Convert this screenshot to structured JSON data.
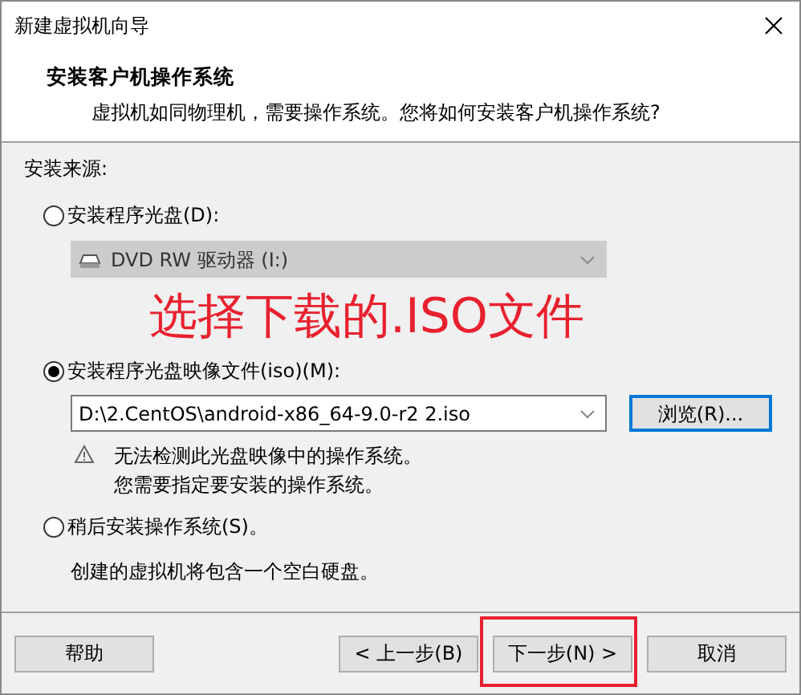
{
  "window": {
    "title": "新建虚拟机向导"
  },
  "header": {
    "title": "安装客户机操作系统",
    "subtitle": "虚拟机如同物理机，需要操作系统。您将如何安装客户机操作系统?"
  },
  "source_label": "安装来源:",
  "options": [
    {
      "kind": "disc",
      "label": "安装程序光盘(D):",
      "selected": false,
      "drive": {
        "value": "DVD RW 驱动器 (I:)",
        "disabled": true
      }
    },
    {
      "kind": "iso",
      "label": "安装程序光盘映像文件(iso)(M):",
      "selected": true,
      "path": "D:\\2.CentOS\\android-x86_64-9.0-r2 2.iso",
      "browse_button": "浏览(R)...",
      "warning": [
        "无法检测此光盘映像中的操作系统。",
        "您需要指定要安装的操作系统。"
      ]
    },
    {
      "kind": "later",
      "label": "稍后安装操作系统(S)。",
      "selected": false,
      "note": "创建的虚拟机将包含一个空白硬盘。"
    }
  ],
  "annotation": "选择下载的.ISO文件",
  "buttons": [
    {
      "label": "帮助",
      "highlighted": false
    },
    {
      "label": "< 上一步(B)",
      "highlighted": false
    },
    {
      "label": "下一步(N) >",
      "highlighted": true
    },
    {
      "label": "取消",
      "highlighted": false
    }
  ]
}
